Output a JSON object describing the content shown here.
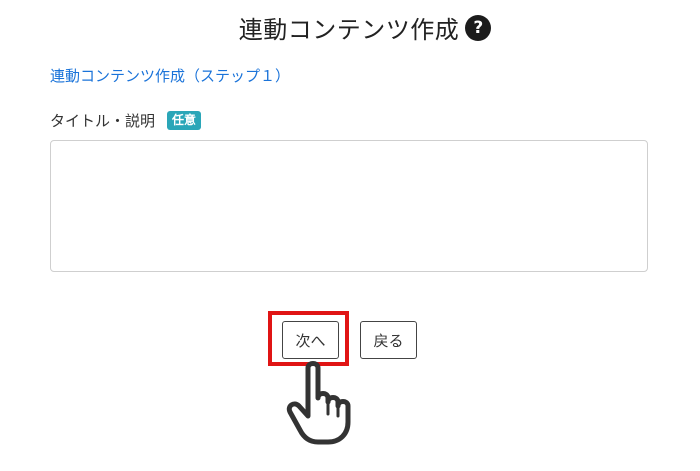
{
  "header": {
    "title": "連動コンテンツ作成",
    "help_icon": "question-circle-icon"
  },
  "breadcrumb": {
    "step_link": "連動コンテンツ作成（ステップ１）"
  },
  "form": {
    "description_label": "タイトル・説明",
    "optional_badge": "任意",
    "description_value": "",
    "description_placeholder": ""
  },
  "actions": {
    "next_label": "次へ",
    "back_label": "戻る"
  },
  "annotation": {
    "highlight_color": "#e01414",
    "pointer_icon": "hand-pointer-icon"
  }
}
